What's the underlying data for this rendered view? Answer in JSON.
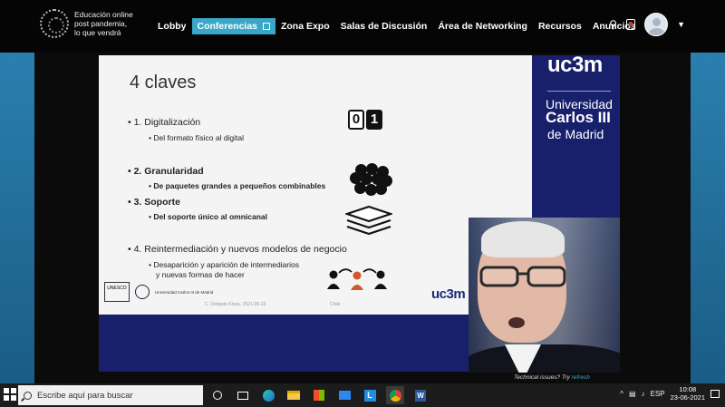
{
  "brand": {
    "text_line1": "Educación online",
    "text_line2": "post pandemia,",
    "text_line3": "lo que vendrá"
  },
  "nav": {
    "items": [
      "Lobby",
      "Conferencias",
      "Zona Expo",
      "Salas de Discusión",
      "Área de Networking",
      "Recursos",
      "Anuncios"
    ],
    "active_index": 1,
    "active_color": "#3aa7c9"
  },
  "slide": {
    "title": "4 claves",
    "points": [
      {
        "label": "1. Digitalización",
        "sub": "Del formato físico al digital",
        "bold": false
      },
      {
        "label": "2. Granularidad",
        "sub": "De paquetes grandes a pequeños combinables",
        "bold": true
      },
      {
        "label": "3. Soporte",
        "sub": "Del soporte único al omnicanal",
        "bold": true
      },
      {
        "label": "4. Reintermediación y nuevos modelos de negocio",
        "sub": "Desaparición y aparición de intermediarios",
        "sub2": "y nuevas formas de hacer",
        "bold": false
      }
    ],
    "binary_icon": [
      "0",
      "1"
    ],
    "footer_left": "C. Delgado Kloos, 2021-06-23",
    "footer_mid": "Chile",
    "uc3m_small": "uc3m",
    "logos": {
      "unesco": "UNESCO",
      "ucc": "Universidad Carlos III de Madrid"
    }
  },
  "university": {
    "logo": "uc3m",
    "line1": "Universidad",
    "line2": "Carlos III",
    "line3": "de Madrid",
    "brand_color": "#18206b"
  },
  "webcam": {
    "notice_prefix": "Technical issues? Try",
    "notice_link": "refresh"
  },
  "taskbar": {
    "search_placeholder": "Escribe aquí para buscar",
    "language": "ESP",
    "time": "10:08",
    "date": "23-06-2021"
  }
}
